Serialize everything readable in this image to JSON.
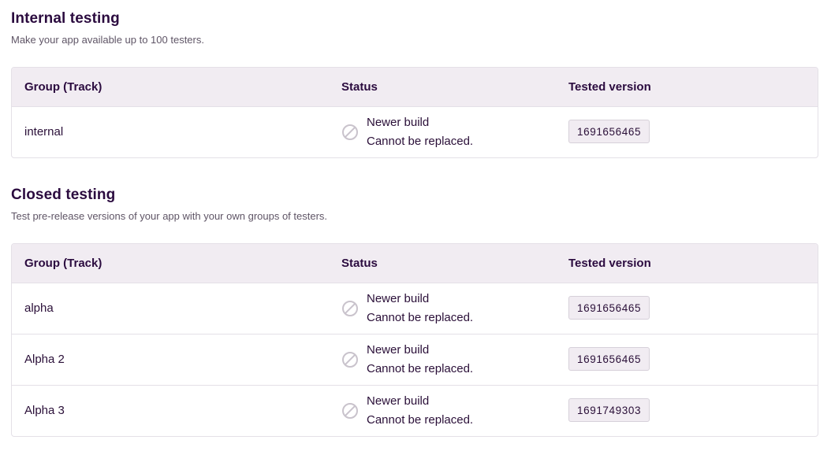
{
  "internal": {
    "title": "Internal testing",
    "subtitle": "Make your app available up to 100 testers.",
    "headers": {
      "group": "Group (Track)",
      "status": "Status",
      "version": "Tested version"
    },
    "rows": [
      {
        "group": "internal",
        "status_line1": "Newer build",
        "status_line2": "Cannot be replaced.",
        "status_icon": "blocked-icon",
        "version": "1691656465"
      }
    ]
  },
  "closed": {
    "title": "Closed testing",
    "subtitle": "Test pre-release versions of your app with your own groups of testers.",
    "headers": {
      "group": "Group (Track)",
      "status": "Status",
      "version": "Tested version"
    },
    "rows": [
      {
        "group": "alpha",
        "status_line1": "Newer build",
        "status_line2": "Cannot be replaced.",
        "status_icon": "blocked-icon",
        "version": "1691656465"
      },
      {
        "group": "Alpha 2",
        "status_line1": "Newer build",
        "status_line2": "Cannot be replaced.",
        "status_icon": "blocked-icon",
        "version": "1691656465"
      },
      {
        "group": "Alpha 3",
        "status_line1": "Newer build",
        "status_line2": "Cannot be replaced.",
        "status_icon": "blocked-icon",
        "version": "1691749303"
      }
    ]
  },
  "colors": {
    "heading": "#2b0b3f",
    "header_bg": "#f1ecf2",
    "border": "#e4e0e7",
    "icon": "#c9c3cc"
  }
}
